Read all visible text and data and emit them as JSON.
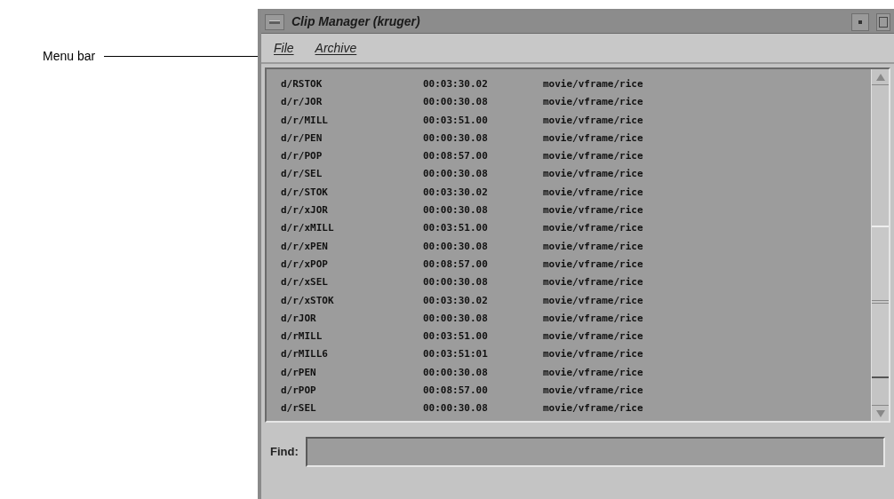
{
  "callout": {
    "label": "Menu bar"
  },
  "window": {
    "title": "Clip Manager (kruger)"
  },
  "menu": [
    "File",
    "Archive"
  ],
  "rows": [
    [
      "d/RSTOK",
      "00:03:30.02",
      "movie/vframe/rice"
    ],
    [
      "d/r/JOR",
      "00:00:30.08",
      "movie/vframe/rice"
    ],
    [
      "d/r/MILL",
      "00:03:51.00",
      "movie/vframe/rice"
    ],
    [
      "d/r/PEN",
      "00:00:30.08",
      "movie/vframe/rice"
    ],
    [
      "d/r/POP",
      "00:08:57.00",
      "movie/vframe/rice"
    ],
    [
      "d/r/SEL",
      "00:00:30.08",
      "movie/vframe/rice"
    ],
    [
      "d/r/STOK",
      "00:03:30.02",
      "movie/vframe/rice"
    ],
    [
      "d/r/xJOR",
      "00:00:30.08",
      "movie/vframe/rice"
    ],
    [
      "d/r/xMILL",
      "00:03:51.00",
      "movie/vframe/rice"
    ],
    [
      "d/r/xPEN",
      "00:00:30.08",
      "movie/vframe/rice"
    ],
    [
      "d/r/xPOP",
      "00:08:57.00",
      "movie/vframe/rice"
    ],
    [
      "d/r/xSEL",
      "00:00:30.08",
      "movie/vframe/rice"
    ],
    [
      "d/r/xSTOK",
      "00:03:30.02",
      "movie/vframe/rice"
    ],
    [
      "d/rJOR",
      "00:00:30.08",
      "movie/vframe/rice"
    ],
    [
      "d/rMILL",
      "00:03:51.00",
      "movie/vframe/rice"
    ],
    [
      "d/rMILL6",
      "00:03:51:01",
      "movie/vframe/rice"
    ],
    [
      "d/rPEN",
      "00:00:30.08",
      "movie/vframe/rice"
    ],
    [
      "d/rPOP",
      "00:08:57.00",
      "movie/vframe/rice"
    ],
    [
      "d/rSEL",
      "00:00:30.08",
      "movie/vframe/rice"
    ]
  ],
  "find": {
    "label": "Find:"
  }
}
